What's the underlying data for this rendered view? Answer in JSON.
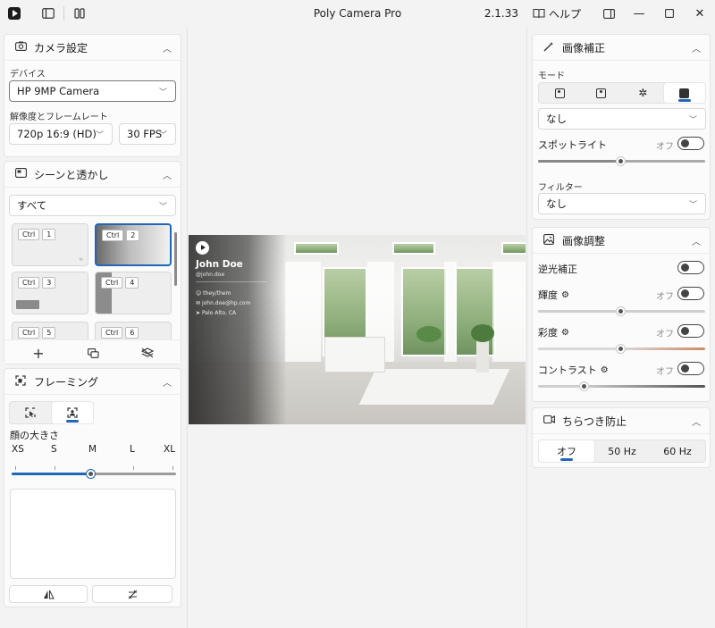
{
  "titlebar": {
    "title": "Poly Camera Pro",
    "version": "2.1.33",
    "help": "ヘルプ"
  },
  "camera": {
    "header": "カメラ設定",
    "device_label": "デバイス",
    "device_value": "HP 9MP Camera",
    "res_label": "解像度とフレームレート",
    "resolution": "720p 16:9 (HD)",
    "fps": "30 FPS"
  },
  "scenes": {
    "header": "シーンと透かし",
    "filter": "すべて",
    "ctrl": "Ctrl",
    "tiles": [
      "1",
      "2",
      "3",
      "4",
      "5",
      "6"
    ]
  },
  "framing": {
    "header": "フレーミング",
    "face_size_label": "顔の大きさ",
    "sizes": [
      "XS",
      "S",
      "M",
      "L",
      "XL"
    ],
    "selected_size": "M"
  },
  "preview": {
    "name": "John Doe",
    "handle": "@john.doe",
    "pronouns": "they/them",
    "email": "john.doe@hp.com",
    "location": "Palo Alto, CA"
  },
  "enhance": {
    "header": "画像補正",
    "mode_label": "モード",
    "mode_value": "なし",
    "spotlight_label": "スポットライト",
    "off": "オフ",
    "filter_label": "フィルター",
    "filter_value": "なし"
  },
  "adjust": {
    "header": "画像調整",
    "backlight": "逆光補正",
    "brightness": "輝度",
    "saturation": "彩度",
    "contrast": "コントラスト",
    "off": "オフ",
    "accent_color": "#d08a6a"
  },
  "flicker": {
    "header": "ちらつき防止",
    "options": [
      "オフ",
      "50 Hz",
      "60 Hz"
    ],
    "selected": "オフ"
  },
  "accent": "#1f67b7"
}
